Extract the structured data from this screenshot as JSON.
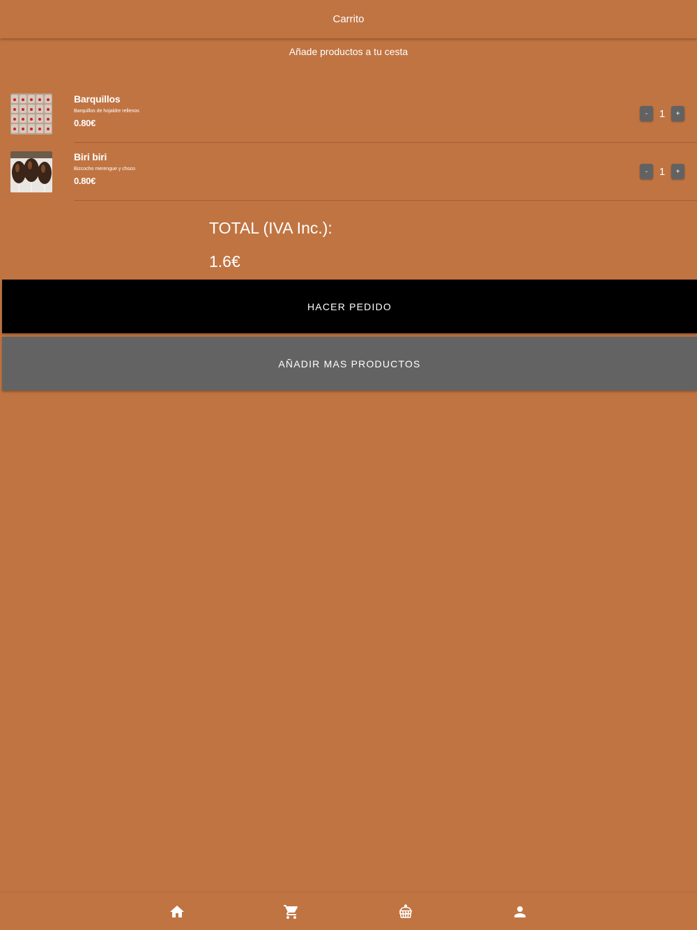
{
  "header": {
    "title": "Carrito"
  },
  "subtitle": "Añade productos a tu cesta",
  "cart": {
    "items": [
      {
        "name": "Barquillos",
        "description": "Barquillos de hojaldre rellenos",
        "price": "0.80€",
        "quantity": "1",
        "minus_label": "-",
        "plus_label": "+"
      },
      {
        "name": "Biri biri",
        "description": "Bizcocho merengue y choco",
        "price": "0.80€",
        "quantity": "1",
        "minus_label": "-",
        "plus_label": "+"
      }
    ]
  },
  "total": {
    "label": "TOTAL (IVA Inc.):",
    "value": "1.6€"
  },
  "actions": {
    "order_label": "HACER PEDIDO",
    "add_more_label": "AÑADIR MAS PRODUCTOS"
  },
  "nav": {
    "items": [
      {
        "icon": "home-icon"
      },
      {
        "icon": "cart-icon"
      },
      {
        "icon": "cake-icon"
      },
      {
        "icon": "user-icon"
      }
    ]
  },
  "colors": {
    "background": "#c07442",
    "order_button": "#000000",
    "secondary_button": "#636363",
    "qty_button": "#626262"
  }
}
